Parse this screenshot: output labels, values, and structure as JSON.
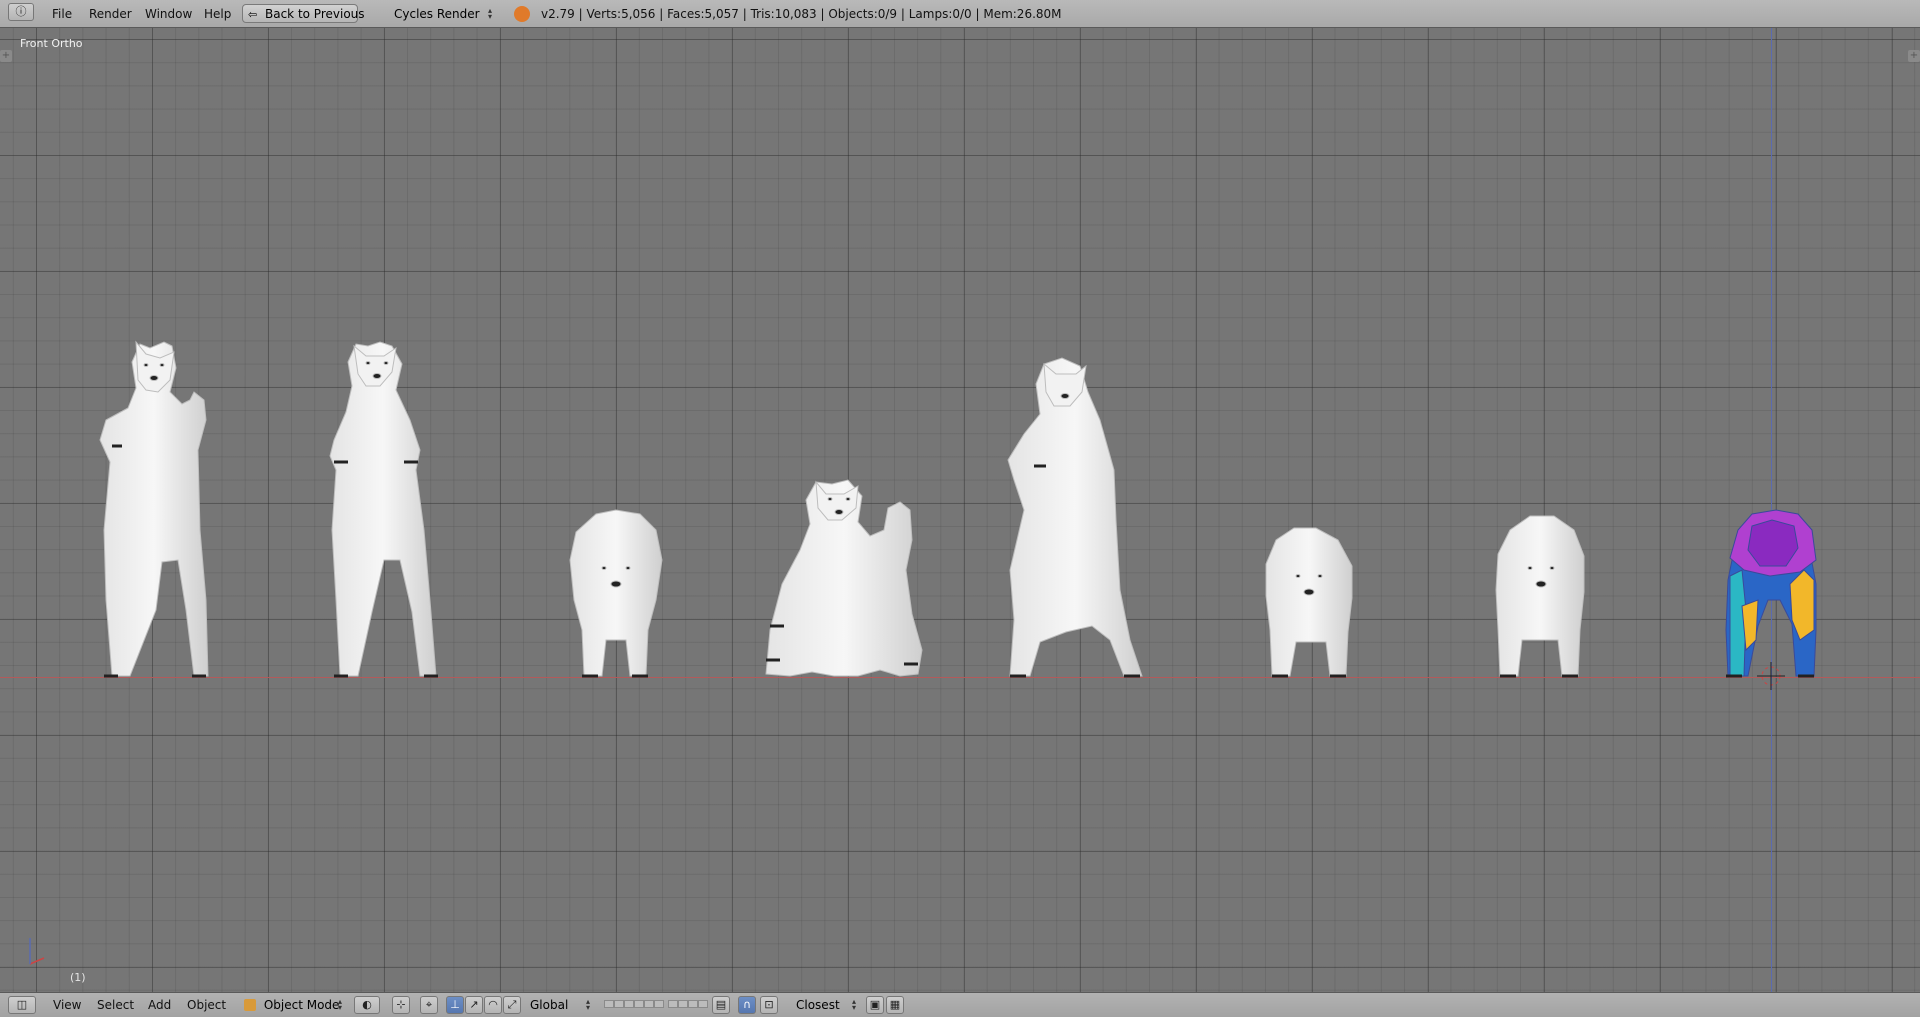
{
  "topbar": {
    "menus": [
      "File",
      "Render",
      "Window",
      "Help"
    ],
    "back_button": "Back to Previous",
    "render_engine": "Cycles Render",
    "stats": "v2.79 | Verts:5,056 | Faces:5,057 | Tris:10,083 | Objects:0/9 | Lamps:0/0 | Mem:26.80M"
  },
  "viewport": {
    "view_label": "Front Ortho",
    "frame_label": "(1)",
    "background_color": "#767676",
    "x_axis_color": "#b35a5a",
    "z_axis_color": "#5a6bb0",
    "objects": [
      {
        "name": "bear-standing-waving",
        "shading": "white"
      },
      {
        "name": "bear-standing",
        "shading": "white"
      },
      {
        "name": "bear-walking",
        "shading": "white"
      },
      {
        "name": "bear-sitting-waving",
        "shading": "white"
      },
      {
        "name": "bear-standing-side",
        "shading": "white"
      },
      {
        "name": "bear-walking",
        "shading": "white"
      },
      {
        "name": "bear-walking",
        "shading": "white"
      },
      {
        "name": "bear-weight-paint",
        "shading": "vertex-colors"
      }
    ]
  },
  "bottombar": {
    "menus": [
      "View",
      "Select",
      "Add",
      "Object"
    ],
    "mode": "Object Mode",
    "orientation": "Global",
    "snap_target": "Closest"
  }
}
